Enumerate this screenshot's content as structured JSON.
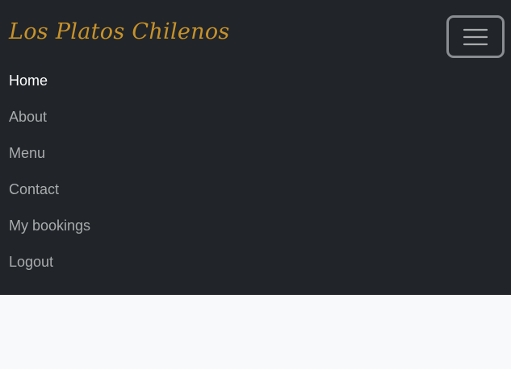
{
  "navbar": {
    "brand": "Los Platos Chilenos",
    "items": [
      {
        "label": "Home",
        "active": true
      },
      {
        "label": "About",
        "active": false
      },
      {
        "label": "Menu",
        "active": false
      },
      {
        "label": "Contact",
        "active": false
      },
      {
        "label": "My bookings",
        "active": false
      },
      {
        "label": "Logout",
        "active": false
      }
    ]
  },
  "colors": {
    "navbar_bg": "#212529",
    "brand": "#c8922a",
    "link": "#a9abad",
    "link_active": "#ffffff",
    "page_bg": "#f8f9fa"
  },
  "icons": {
    "toggler": "hamburger-menu-icon"
  }
}
